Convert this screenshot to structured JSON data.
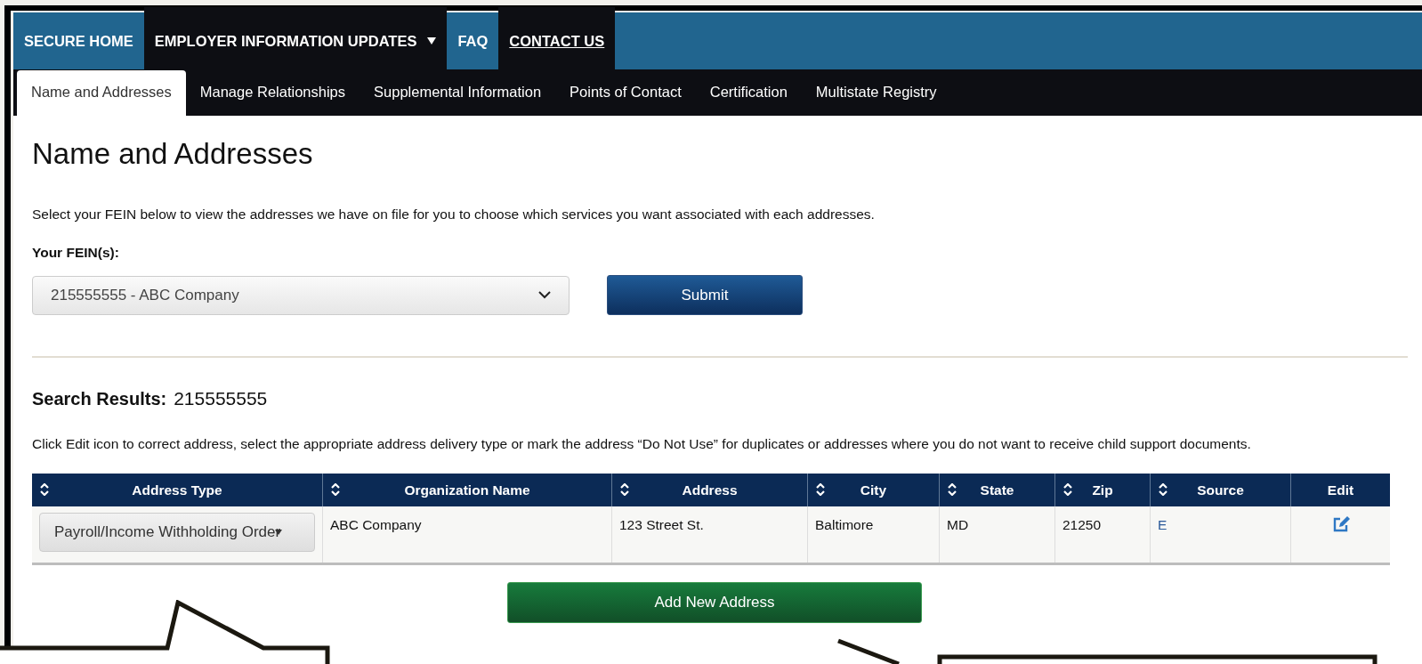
{
  "top_nav": [
    {
      "label": "SECURE HOME",
      "active": false,
      "dropdown": false,
      "underlined": false
    },
    {
      "label": "EMPLOYER INFORMATION UPDATES",
      "active": true,
      "dropdown": true,
      "underlined": false
    },
    {
      "label": "FAQ",
      "active": false,
      "dropdown": false,
      "underlined": false
    },
    {
      "label": "CONTACT US",
      "active": true,
      "dropdown": false,
      "underlined": true
    }
  ],
  "tabs": [
    {
      "label": "Name and Addresses",
      "selected": true
    },
    {
      "label": "Manage Relationships",
      "selected": false
    },
    {
      "label": "Supplemental Information",
      "selected": false
    },
    {
      "label": "Points of Contact",
      "selected": false
    },
    {
      "label": "Certification",
      "selected": false
    },
    {
      "label": "Multistate Registry",
      "selected": false
    }
  ],
  "heading": "Name and Addresses",
  "intro": "Select your FEIN below to view the addresses we have on file for you to choose which services you want associated with each addresses.",
  "fein": {
    "label": "Your FEIN(s):",
    "value": "215555555 - ABC Company"
  },
  "submit_button": "Submit",
  "search_results": {
    "label": "Search Results:",
    "value": "215555555"
  },
  "instructions": "Click Edit icon to correct address, select the appropriate address delivery type or mark the address “Do Not Use” for duplicates or addresses where you do not want to receive child support documents.",
  "table": {
    "columns": [
      {
        "label": "Address Type",
        "sortable": true
      },
      {
        "label": "Organization Name",
        "sortable": true
      },
      {
        "label": "Address",
        "sortable": true
      },
      {
        "label": "City",
        "sortable": true
      },
      {
        "label": "State",
        "sortable": true
      },
      {
        "label": "Zip",
        "sortable": true
      },
      {
        "label": "Source",
        "sortable": true
      },
      {
        "label": "Edit",
        "sortable": false
      }
    ],
    "rows": [
      {
        "cells": [
          {
            "kind": "select",
            "text": "Payroll/Income Withholding Order"
          },
          {
            "kind": "text",
            "text": "ABC Company"
          },
          {
            "kind": "text",
            "text": "123 Street St."
          },
          {
            "kind": "text",
            "text": "Baltimore"
          },
          {
            "kind": "text",
            "text": "MD"
          },
          {
            "kind": "text",
            "text": "21250"
          },
          {
            "kind": "link",
            "text": "E"
          },
          {
            "kind": "edit"
          }
        ]
      }
    ]
  },
  "add_button": "Add New Address"
}
